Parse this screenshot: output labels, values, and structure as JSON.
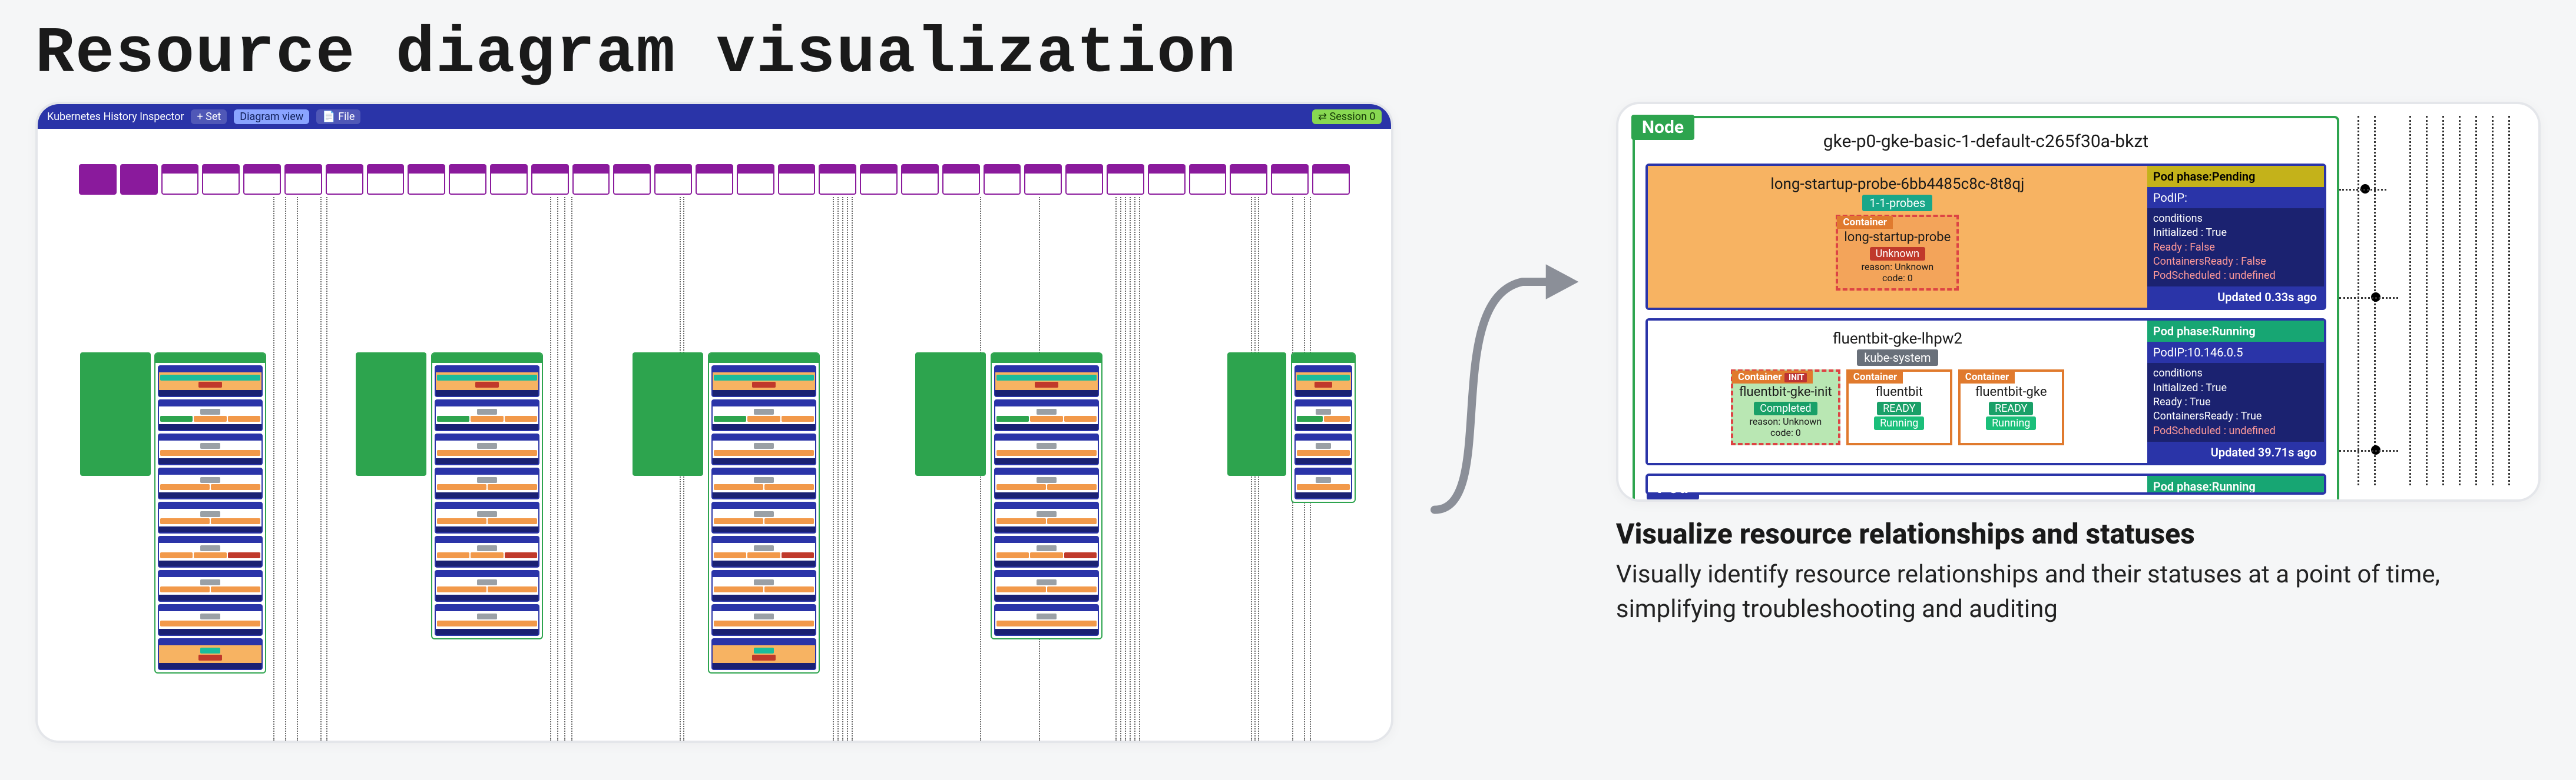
{
  "page": {
    "title": "Resource diagram visualization"
  },
  "app": {
    "brand": "Kubernetes History Inspector",
    "btn_add": "+ Set",
    "tab_diagram": "Diagram view",
    "tab_file": "📄 File",
    "session": "⇄ Session 0"
  },
  "detail": {
    "node_tag": "Node",
    "pod_tag": "Pod",
    "node_name": "gke-p0-gke-basic-1-default-c265f30a-bkzt",
    "pod1": {
      "name": "long-startup-probe-6bb4485c8c-8t8qj",
      "ns": "1-1-probes",
      "container": {
        "badge": "Container",
        "name": "long-startup-probe",
        "state": "Unknown",
        "reason": "reason: Unknown",
        "code": "code: 0"
      },
      "side": {
        "phase": "Pod phase:Pending",
        "podip": "PodIP:",
        "cond_label": "conditions",
        "c1": "Initialized : True",
        "c2": "Ready : False",
        "c3": "ContainersReady : False",
        "c4": "PodScheduled : undefined",
        "updated": "Updated 0.33s ago"
      }
    },
    "pod2": {
      "name": "fluentbit-gke-lhpw2",
      "ns": "kube-system",
      "c1": {
        "badge": "Container",
        "name": "fluentbit-gke-init",
        "state": "Completed",
        "reason": "reason: Unknown",
        "code": "code: 0"
      },
      "c2": {
        "badge": "Container",
        "name": "fluentbit",
        "state": "READY",
        "sub": "Running"
      },
      "c3": {
        "badge": "Container",
        "name": "fluentbit-gke",
        "state": "READY",
        "sub": "Running"
      },
      "side": {
        "phase": "Pod phase:Running",
        "podip": "PodIP:10.146.0.5",
        "cond_label": "conditions",
        "c1": "Initialized : True",
        "c2": "Ready : True",
        "c3": "ContainersReady : True",
        "c4": "PodScheduled : undefined",
        "updated": "Updated 39.71s ago"
      }
    }
  },
  "copy": {
    "heading": "Visualize resource relationships and statuses",
    "body": "Visually identify resource relationships and their statuses at a point of time, simplifying troubleshooting and auditing"
  }
}
